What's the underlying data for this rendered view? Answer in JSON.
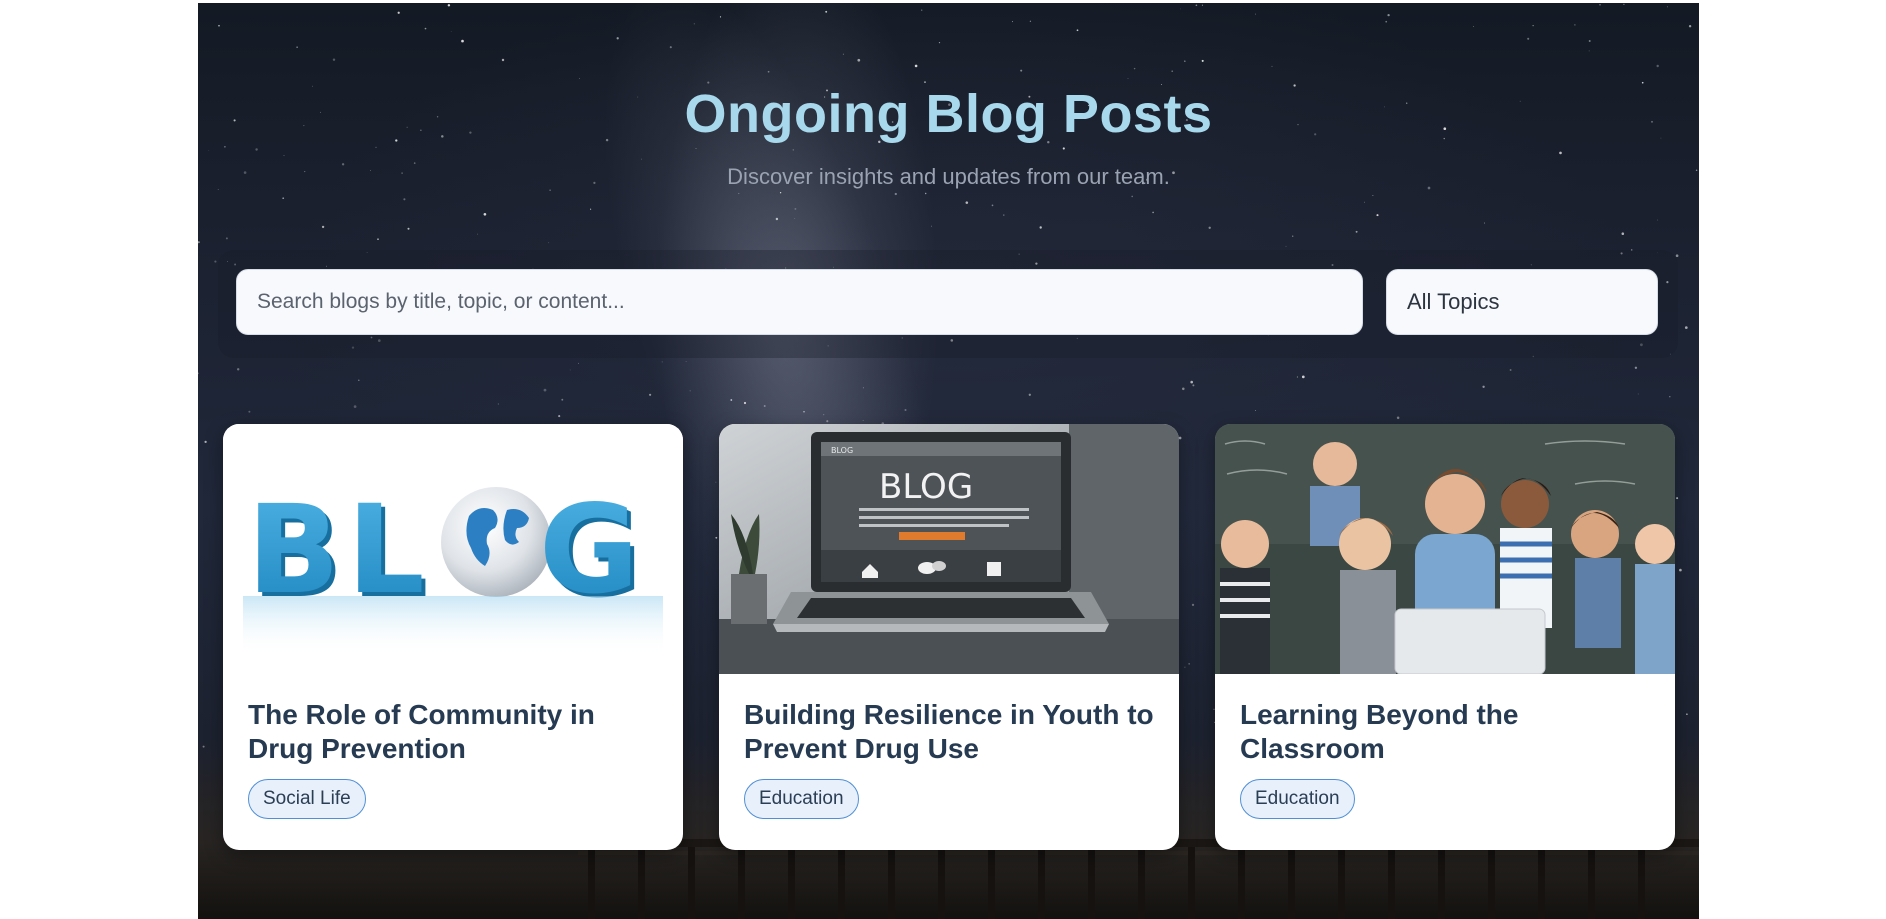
{
  "header": {
    "title": "Ongoing Blog Posts",
    "subtitle": "Discover insights and updates from our team."
  },
  "search": {
    "placeholder": "Search blogs by title, topic, or content..."
  },
  "filter": {
    "selected": "All Topics"
  },
  "posts": [
    {
      "title": "The Role of Community in Drug Prevention",
      "tag": "Social Life",
      "image_word": "BLOG"
    },
    {
      "title": "Building Resilience in Youth to Prevent Drug Use",
      "tag": "Education",
      "image_word": "BLOG"
    },
    {
      "title": "Learning Beyond the Classroom",
      "tag": "Education"
    }
  ],
  "colors": {
    "title": "#a7d8ec",
    "card_title": "#263a52",
    "tag_border": "#4f8fd6",
    "tag_bg": "#e7f0fb"
  }
}
